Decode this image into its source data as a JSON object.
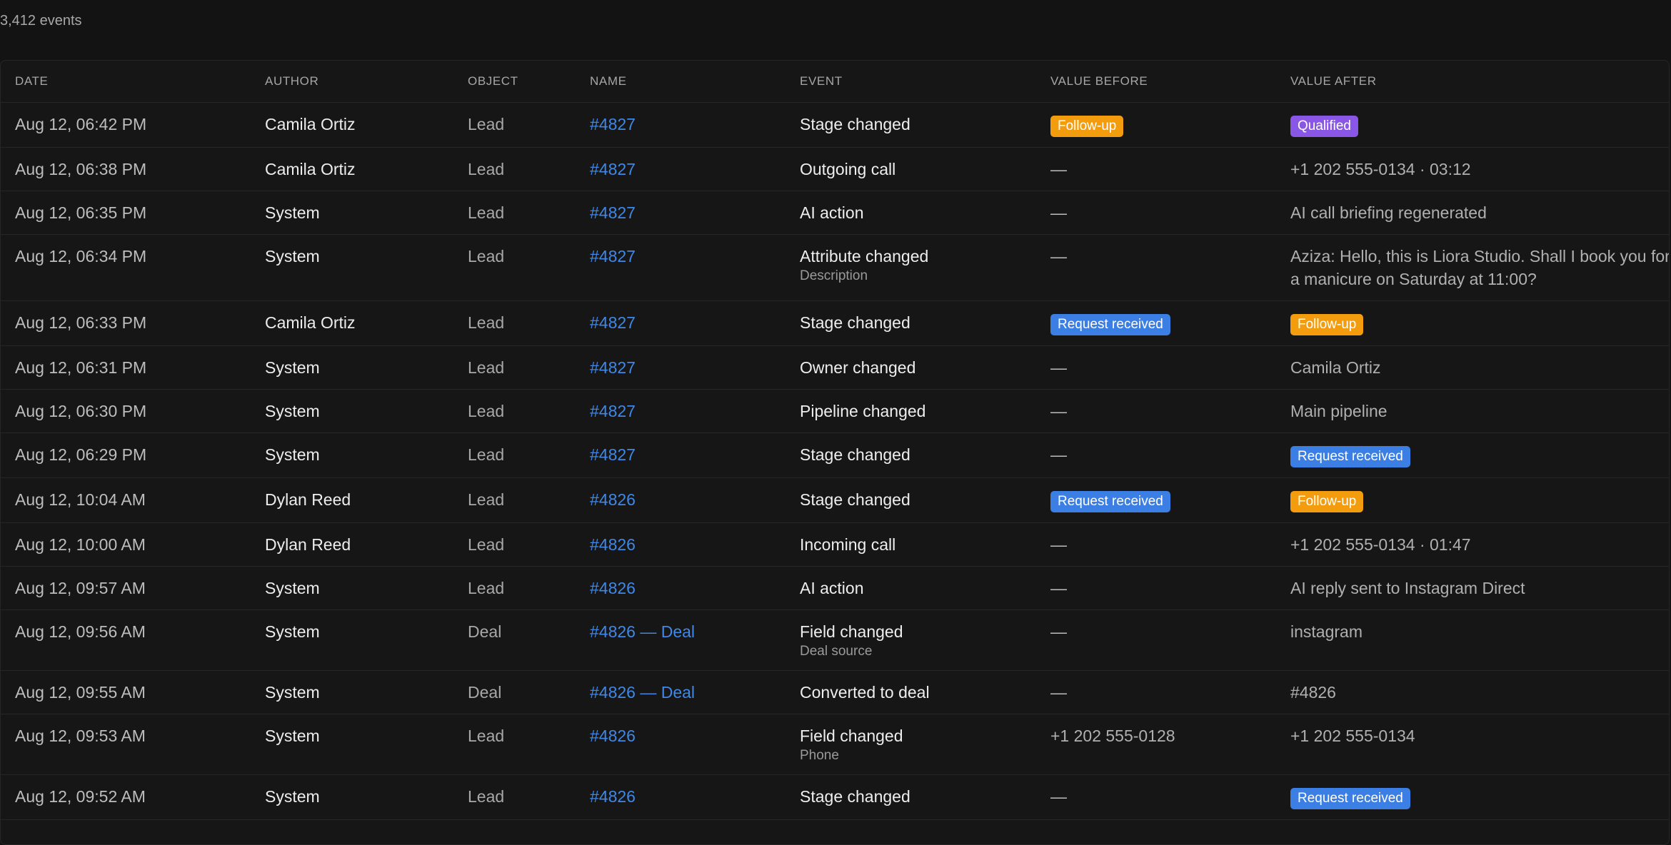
{
  "summary": {
    "count_text": "3,412 events"
  },
  "table": {
    "columns": [
      "DATE",
      "AUTHOR",
      "OBJECT",
      "NAME",
      "EVENT",
      "VALUE BEFORE",
      "VALUE AFTER"
    ],
    "rows": [
      {
        "date": "Aug 12, 06:42 PM",
        "author": "Camila Ortiz",
        "object": "Lead",
        "name": "#4827",
        "event": "Stage changed",
        "event_sub": "",
        "before": {
          "type": "badge",
          "text": "Follow-up",
          "color": "#f39c0e"
        },
        "after": {
          "type": "badge",
          "text": "Qualified",
          "color": "#8a56e6"
        }
      },
      {
        "date": "Aug 12, 06:38 PM",
        "author": "Camila Ortiz",
        "object": "Lead",
        "name": "#4827",
        "event": "Outgoing call",
        "event_sub": "",
        "before": {
          "type": "text",
          "text": "—"
        },
        "after": {
          "type": "text",
          "text": "+1 202 555-0134 · 03:12"
        }
      },
      {
        "date": "Aug 12, 06:35 PM",
        "author": "System",
        "object": "Lead",
        "name": "#4827",
        "event": "AI action",
        "event_sub": "",
        "before": {
          "type": "text",
          "text": "—"
        },
        "after": {
          "type": "text",
          "text": "AI call briefing regenerated"
        }
      },
      {
        "date": "Aug 12, 06:34 PM",
        "author": "System",
        "object": "Lead",
        "name": "#4827",
        "event": "Attribute changed",
        "event_sub": "Description",
        "before": {
          "type": "text",
          "text": "—"
        },
        "after": {
          "type": "text",
          "text": "Aziza: Hello, this is Liora Studio. Shall I book you for a manicure on Saturday at 11:00?"
        }
      },
      {
        "date": "Aug 12, 06:33 PM",
        "author": "Camila Ortiz",
        "object": "Lead",
        "name": "#4827",
        "event": "Stage changed",
        "event_sub": "",
        "before": {
          "type": "badge",
          "text": "Request received",
          "color": "#3b7fe4"
        },
        "after": {
          "type": "badge",
          "text": "Follow-up",
          "color": "#f39c0e"
        }
      },
      {
        "date": "Aug 12, 06:31 PM",
        "author": "System",
        "object": "Lead",
        "name": "#4827",
        "event": "Owner changed",
        "event_sub": "",
        "before": {
          "type": "text",
          "text": "—"
        },
        "after": {
          "type": "text",
          "text": "Camila Ortiz"
        }
      },
      {
        "date": "Aug 12, 06:30 PM",
        "author": "System",
        "object": "Lead",
        "name": "#4827",
        "event": "Pipeline changed",
        "event_sub": "",
        "before": {
          "type": "text",
          "text": "—"
        },
        "after": {
          "type": "text",
          "text": "Main pipeline"
        }
      },
      {
        "date": "Aug 12, 06:29 PM",
        "author": "System",
        "object": "Lead",
        "name": "#4827",
        "event": "Stage changed",
        "event_sub": "",
        "before": {
          "type": "text",
          "text": "—"
        },
        "after": {
          "type": "badge",
          "text": "Request received",
          "color": "#3b7fe4"
        }
      },
      {
        "date": "Aug 12, 10:04 AM",
        "author": "Dylan Reed",
        "object": "Lead",
        "name": "#4826",
        "event": "Stage changed",
        "event_sub": "",
        "before": {
          "type": "badge",
          "text": "Request received",
          "color": "#3b7fe4"
        },
        "after": {
          "type": "badge",
          "text": "Follow-up",
          "color": "#f39c0e"
        }
      },
      {
        "date": "Aug 12, 10:00 AM",
        "author": "Dylan Reed",
        "object": "Lead",
        "name": "#4826",
        "event": "Incoming call",
        "event_sub": "",
        "before": {
          "type": "text",
          "text": "—"
        },
        "after": {
          "type": "text",
          "text": "+1 202 555-0134 · 01:47"
        }
      },
      {
        "date": "Aug 12, 09:57 AM",
        "author": "System",
        "object": "Lead",
        "name": "#4826",
        "event": "AI action",
        "event_sub": "",
        "before": {
          "type": "text",
          "text": "—"
        },
        "after": {
          "type": "text",
          "text": "AI reply sent to Instagram Direct"
        }
      },
      {
        "date": "Aug 12, 09:56 AM",
        "author": "System",
        "object": "Deal",
        "name": "#4826 — Deal",
        "event": "Field changed",
        "event_sub": "Deal source",
        "before": {
          "type": "text",
          "text": "—"
        },
        "after": {
          "type": "text",
          "text": "instagram"
        }
      },
      {
        "date": "Aug 12, 09:55 AM",
        "author": "System",
        "object": "Deal",
        "name": "#4826 — Deal",
        "event": "Converted to deal",
        "event_sub": "",
        "before": {
          "type": "text",
          "text": "—"
        },
        "after": {
          "type": "text",
          "text": "#4826"
        }
      },
      {
        "date": "Aug 12, 09:53 AM",
        "author": "System",
        "object": "Lead",
        "name": "#4826",
        "event": "Field changed",
        "event_sub": "Phone",
        "before": {
          "type": "text",
          "text": "+1 202 555-0128"
        },
        "after": {
          "type": "text",
          "text": "+1 202 555-0134"
        }
      },
      {
        "date": "Aug 12, 09:52 AM",
        "author": "System",
        "object": "Lead",
        "name": "#4826",
        "event": "Stage changed",
        "event_sub": "",
        "before": {
          "type": "text",
          "text": "—"
        },
        "after": {
          "type": "badge",
          "text": "Request received",
          "color": "#3b7fe4"
        }
      }
    ]
  }
}
